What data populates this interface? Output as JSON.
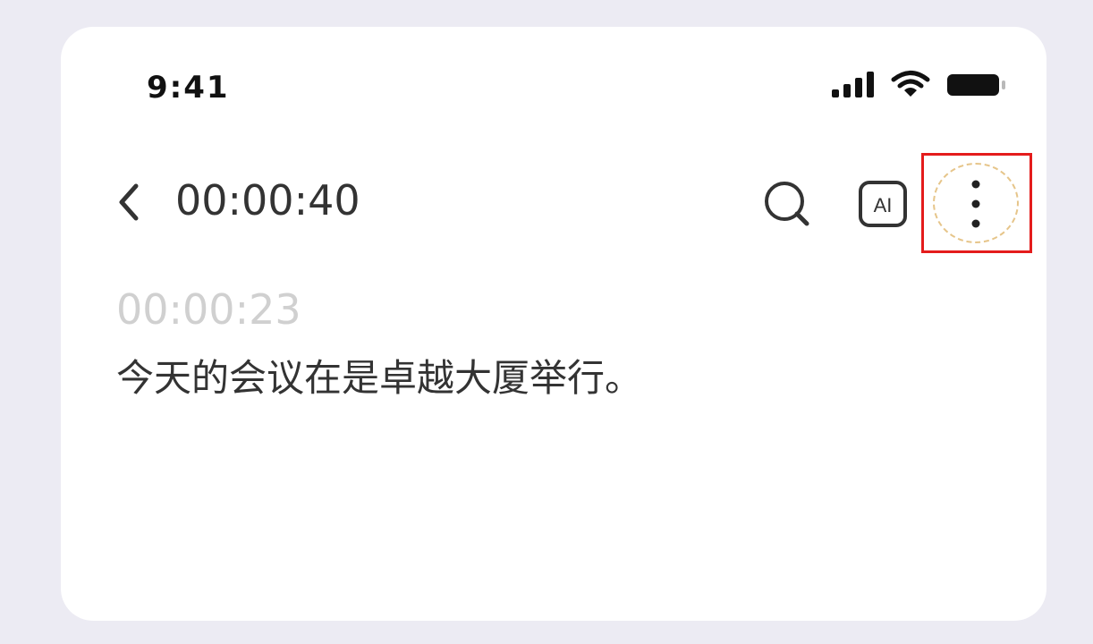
{
  "status_bar": {
    "time": "9:41",
    "icons": [
      "signal-icon",
      "wifi-icon",
      "battery-icon"
    ]
  },
  "header": {
    "back_icon": "chevron-left-icon",
    "title": "00:00:40",
    "actions": [
      {
        "icon": "search-icon"
      },
      {
        "icon": "ai-icon",
        "label": "AI"
      },
      {
        "icon": "more-vertical-icon"
      }
    ]
  },
  "transcript": {
    "timestamp": "00:00:23",
    "text": "今天的会议在是卓越大厦举行。"
  },
  "colors": {
    "page_background": "#ecebf3",
    "card_background": "#ffffff",
    "highlight_border": "#e41c1c",
    "focus_ring": "#e6c58a",
    "timestamp_text": "#d0d0d0",
    "primary_text": "#333333"
  }
}
